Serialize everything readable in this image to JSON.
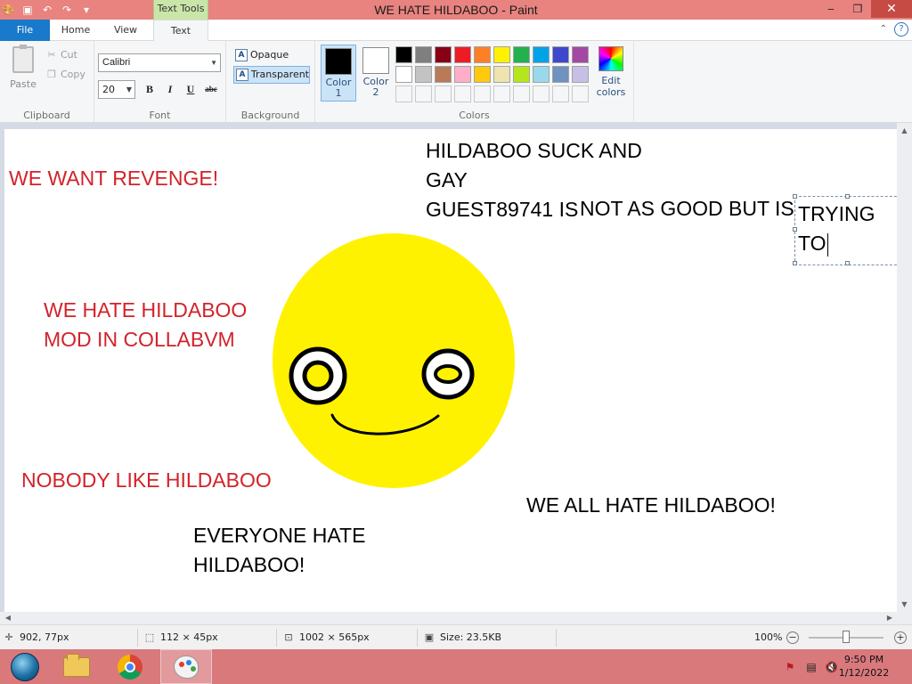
{
  "window": {
    "title": "WE HATE HILDABOO - Paint",
    "context_tab_header": "Text Tools",
    "minimize": "‒",
    "restore": "❐",
    "close": "✕"
  },
  "tabs": {
    "file": "File",
    "home": "Home",
    "view": "View",
    "text": "Text"
  },
  "clipboard": {
    "paste": "Paste",
    "cut": "Cut",
    "copy": "Copy",
    "group_label": "Clipboard"
  },
  "font": {
    "family": "Calibri",
    "size": "20",
    "bold": "B",
    "italic": "I",
    "underline": "U",
    "strikethrough": "abc",
    "group_label": "Font"
  },
  "background": {
    "opaque": "Opaque",
    "transparent": "Transparent",
    "group_label": "Background"
  },
  "colors": {
    "color1_label": "Color\n1",
    "color2_label": "Color\n2",
    "color1_value": "#000000",
    "color2_value": "#ffffff",
    "edit_colors": "Edit\ncolors",
    "group_label": "Colors",
    "palette": [
      "#000000",
      "#7f7f7f",
      "#880015",
      "#ed1c24",
      "#ff7f27",
      "#fff200",
      "#22b14c",
      "#00a2e8",
      "#3f48cc",
      "#a349a4",
      "#ffffff",
      "#c3c3c3",
      "#b97a57",
      "#ffaec9",
      "#ffc90e",
      "#efe4b0",
      "#b5e61d",
      "#99d9ea",
      "#7092be",
      "#c8bfe7"
    ],
    "empty_swatches": 10
  },
  "canvas_texts": [
    {
      "id": "revenge",
      "lines": "WE WANT REVENGE!",
      "color": "red"
    },
    {
      "id": "mod",
      "lines": "WE HATE HILDABOO\nMOD IN COLLABVM",
      "color": "red"
    },
    {
      "id": "nobody",
      "lines": "NOBODY LIKE HILDABOO",
      "color": "red"
    },
    {
      "id": "suck",
      "lines": "HILDABOO SUCK AND\nGAY\nGUEST89741 IS",
      "color": "black"
    },
    {
      "id": "notgood",
      "lines": "NOT AS GOOD BUT IS",
      "color": "black"
    },
    {
      "id": "trying",
      "lines": "TRYING\nTO",
      "color": "black"
    },
    {
      "id": "allhate",
      "lines": "WE ALL HATE HILDABOO!",
      "color": "black"
    },
    {
      "id": "everyone",
      "lines": "EVERYONE HATE\nHILDABOO!",
      "color": "black"
    }
  ],
  "status": {
    "cursor_pos": "902, 77px",
    "selection_size": "112 × 45px",
    "image_size": "1002 × 565px",
    "file_size": "Size: 23.5KB",
    "zoom": "100%"
  },
  "taskbar": {
    "time": "9:50 PM",
    "date": "1/12/2022"
  }
}
